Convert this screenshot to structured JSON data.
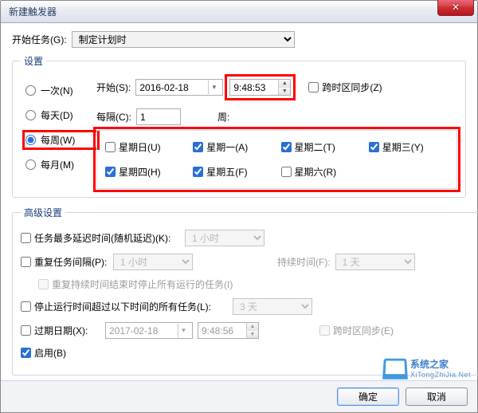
{
  "title": "新建触发器",
  "begin_task_label": "开始任务(G):",
  "begin_task_value": "制定计划时",
  "settings_legend": "设置",
  "schedule": {
    "once": "一次(N)",
    "daily": "每天(D)",
    "weekly": "每周(W)",
    "monthly": "每月(M)"
  },
  "start_label": "开始(S):",
  "start_date": "2016-02-18",
  "start_time": "9:48:53",
  "sync_tz": "跨时区同步(Z)",
  "every_label": "每隔(C):",
  "every_value": "1",
  "every_unit": "周:",
  "days": {
    "sun": "星期日(U)",
    "mon": "星期一(A)",
    "tue": "星期二(T)",
    "wed": "星期三(Y)",
    "thu": "星期四(H)",
    "fri": "星期五(F)",
    "sat": "星期六(R)"
  },
  "adv_legend": "高级设置",
  "adv": {
    "delay_label": "任务最多延迟时间(随机延迟)(K):",
    "delay_value": "1 小时",
    "repeat_label": "重复任务间隔(P):",
    "repeat_value": "1 小时",
    "duration_label": "持续时间(F):",
    "duration_value": "1 天",
    "stop_running_label": "重复持续时间结束时停止所有运行的任务(I)",
    "stop_after_label": "停止运行时间超过以下时间的所有任务(L):",
    "stop_after_value": "3 天",
    "expire_label": "过期日期(X):",
    "expire_date": "2017-02-18",
    "expire_time": "9:48:56",
    "sync_tz2": "跨时区同步(E)",
    "enabled_label": "启用(B)"
  },
  "buttons": {
    "ok": "确定",
    "cancel": "取消"
  },
  "watermark": {
    "text": "系统之家",
    "url": "XiTongZhiJia.Net"
  }
}
